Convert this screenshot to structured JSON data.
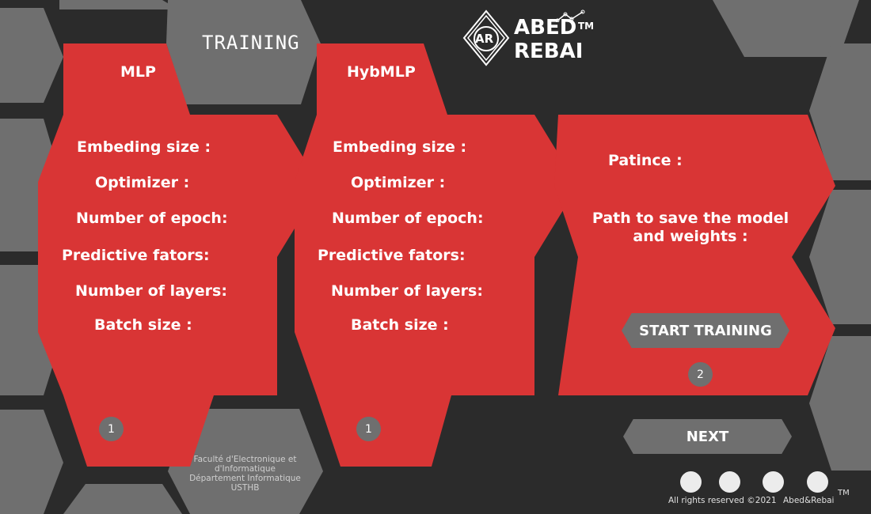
{
  "page_title": "TRAINING",
  "logo": {
    "initials": "AR",
    "line1": "ABED",
    "line2": "REBAI",
    "trademark": "TM"
  },
  "panels": {
    "mlp": {
      "title": "MLP",
      "fields": [
        "Embeding size :",
        "Optimizer :",
        "Number of epoch:",
        "Predictive fators:",
        "Number of layers:",
        "Batch size :"
      ],
      "step": "1"
    },
    "hybmlp": {
      "title": "HybMLP",
      "fields": [
        "Embeding size :",
        "Optimizer :",
        "Number of epoch:",
        "Predictive fators:",
        "Number of layers:",
        "Batch size :"
      ],
      "step": "1"
    },
    "common": {
      "patience_label": "Patince :",
      "path_label_line1": "Path to save the model",
      "path_label_line2": "and weights :",
      "start_button": "START TRAINING",
      "step": "2"
    }
  },
  "next_button": "NEXT",
  "footer": {
    "line1": "Faculté d'Electronique et",
    "line2": "d'Informatique",
    "line3": "Département Informatique",
    "line4": "USTHB",
    "copyright": "All rights reserved ©2021",
    "brand": "Abed&Rebai",
    "trademark": "TM"
  },
  "colors": {
    "background": "#2b2b2b",
    "hex_gray": "#6f6f6f",
    "panel_red": "#d93535",
    "text": "#ffffff"
  }
}
